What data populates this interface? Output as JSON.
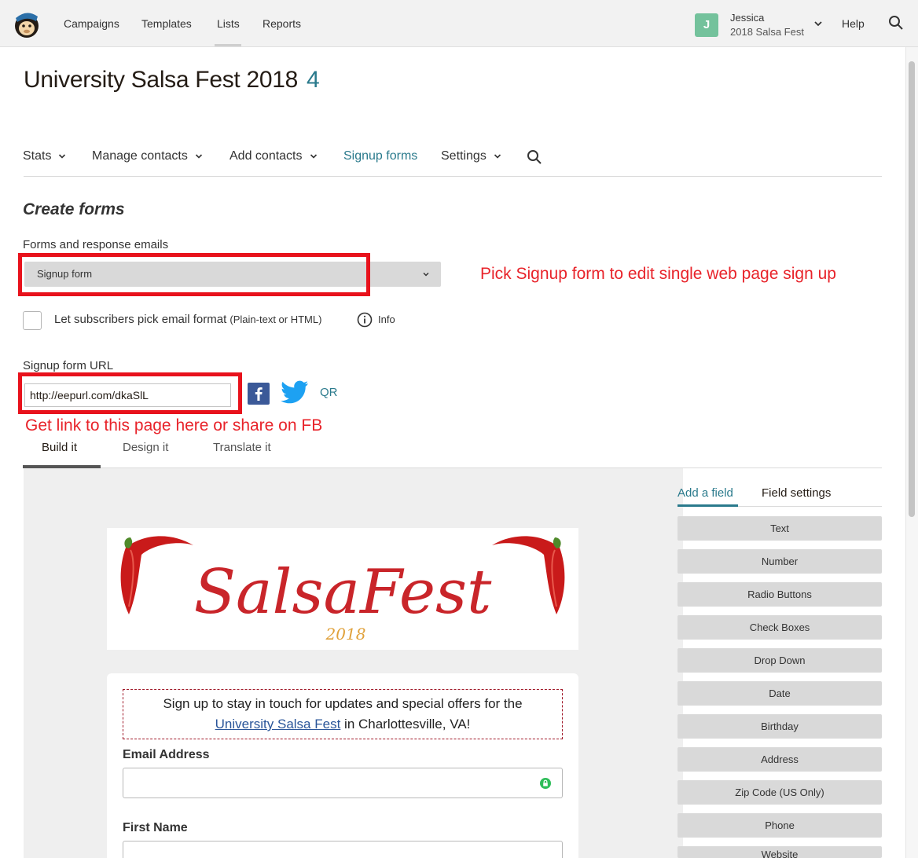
{
  "topbar": {
    "nav": [
      "Campaigns",
      "Templates",
      "Lists",
      "Reports"
    ],
    "active_nav": "Lists",
    "avatar_initial": "J",
    "account_name": "Jessica",
    "account_org": "2018 Salsa Fest",
    "help": "Help"
  },
  "list": {
    "title": "University Salsa Fest 2018",
    "count": "4"
  },
  "subnav": {
    "stats": "Stats",
    "manage": "Manage contacts",
    "add": "Add contacts",
    "signup": "Signup forms",
    "settings": "Settings"
  },
  "create": {
    "heading": "Create forms",
    "forms_label": "Forms and response emails",
    "select_value": "Signup form",
    "annotation_1": "Pick Signup form to edit single web page sign up",
    "checkbox_label": "Let subscribers pick email format",
    "checkbox_sub": "(Plain-text or HTML)",
    "info": "Info",
    "url_label": "Signup form URL",
    "url_value": "http://eepurl.com/dkaSlL",
    "qr": "QR",
    "annotation_2": "Get link to this page here or share on FB"
  },
  "tabs": [
    "Build it",
    "Design it",
    "Translate it"
  ],
  "form_preview": {
    "banner_title": "SalsaFest",
    "banner_year": "2018",
    "intro_text": "Sign up to stay in touch for updates and special offers for the",
    "intro_link": "University Salsa Fest",
    "intro_tail": " in Charlottesville, VA!",
    "email_label": "Email Address",
    "first_name_label": "First Name"
  },
  "sidebar": {
    "tab_add": "Add a field",
    "tab_settings": "Field settings",
    "fields": [
      "Text",
      "Number",
      "Radio Buttons",
      "Check Boxes",
      "Drop Down",
      "Date",
      "Birthday",
      "Address",
      "Zip Code (US Only)",
      "Phone",
      "Website"
    ]
  },
  "colors": {
    "accent": "#2a7a8c",
    "annotation_red": "#e8232a",
    "avatar": "#74c29c"
  }
}
